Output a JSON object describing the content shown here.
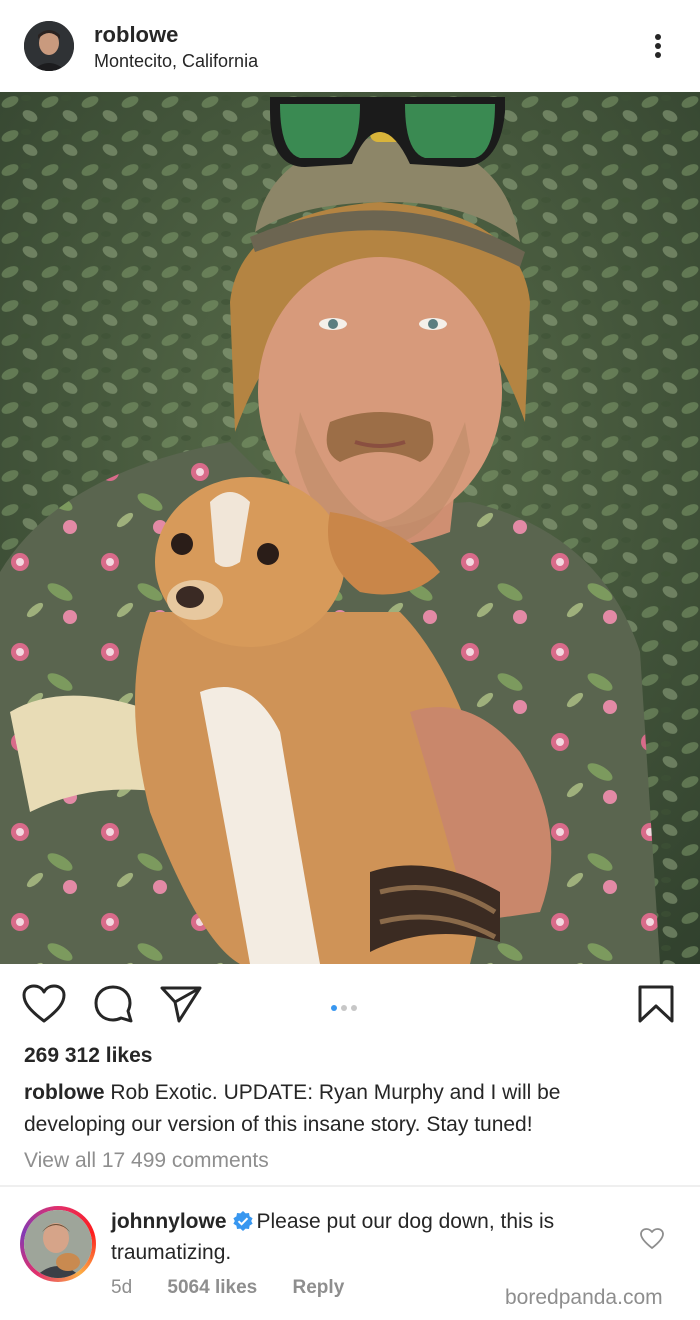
{
  "post": {
    "username": "roblowe",
    "location": "Montecito, California",
    "likes": "269 312 likes",
    "caption_user": "roblowe",
    "caption_text": "Rob Exotic.  UPDATE: Ryan Murphy and I will be developing our version of this insane story. Stay tuned!",
    "view_comments": "View all 17 499 comments",
    "carousel": {
      "count": 3,
      "active": 1
    }
  },
  "icons": {
    "more": "more-vertical-icon",
    "like": "heart-icon",
    "comment": "comment-bubble-icon",
    "share": "send-icon",
    "save": "bookmark-icon",
    "verified": "verified-badge-icon"
  },
  "comment": {
    "username": "johnnylowe",
    "text": "Please put our dog down, this is traumatizing.",
    "age": "5d",
    "likes": "5064 likes",
    "reply": "Reply"
  },
  "watermark": "boredpanda.com",
  "colors": {
    "text": "#262626",
    "secondary": "#8e8e8e",
    "accent": "#3897f0",
    "verified": "#3897f0"
  }
}
